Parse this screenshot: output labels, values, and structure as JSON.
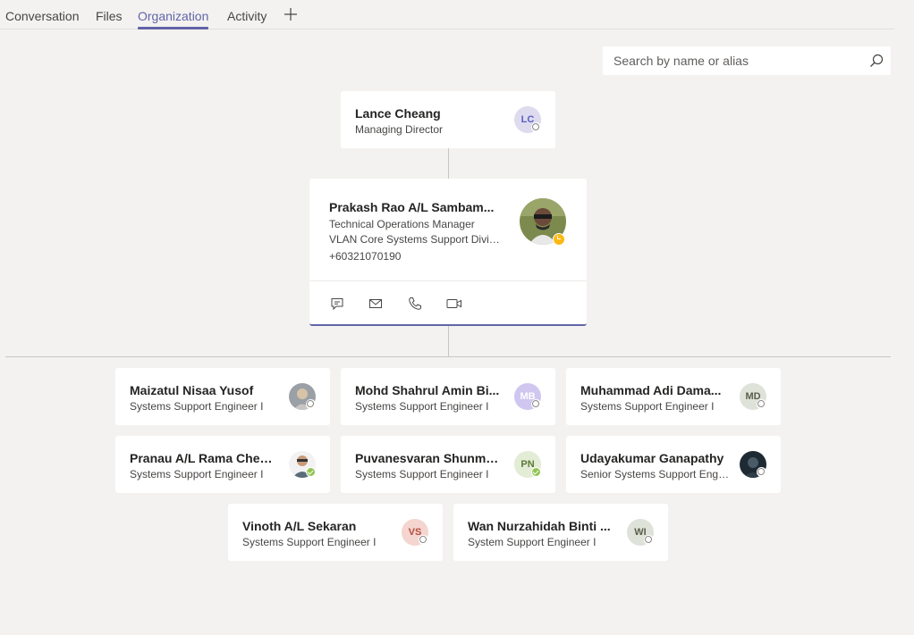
{
  "tabs": [
    {
      "label": "Conversation"
    },
    {
      "label": "Files"
    },
    {
      "label": "Organization"
    },
    {
      "label": "Activity"
    }
  ],
  "search": {
    "placeholder": "Search by name or alias"
  },
  "manager": {
    "name": "Lance Cheang",
    "title": "Managing Director",
    "initials": "LC"
  },
  "focus": {
    "name": "Prakash Rao A/L Sambam...",
    "title": "Technical Operations Manager",
    "department": "VLAN Core Systems Support Divis...",
    "phone": "+60321070190"
  },
  "reports": [
    {
      "name": "Maizatul Nisaa Yusof",
      "title": "Systems Support Engineer I"
    },
    {
      "name": "Mohd Shahrul Amin Bi...",
      "title": "Systems Support Engineer I",
      "initials": "MB"
    },
    {
      "name": "Muhammad Adi Dama...",
      "title": "Systems Support Engineer I",
      "initials": "MD"
    },
    {
      "name": "Pranau A/L Rama Chen...",
      "title": "Systems Support Engineer I"
    },
    {
      "name": "Puvanesvaran Shunmu...",
      "title": "Systems Support Engineer I",
      "initials": "PN"
    },
    {
      "name": "Udayakumar Ganapathy",
      "title": "Senior Systems Support Engin..."
    },
    {
      "name": "Vinoth A/L Sekaran",
      "title": "Systems Support Engineer I",
      "initials": "VS"
    },
    {
      "name": "Wan Nurzahidah Binti ...",
      "title": "System Support Engineer I",
      "initials": "WI"
    }
  ],
  "colors": {
    "accent": "#6264a7",
    "available": "#92c353",
    "away": "#fdb913"
  }
}
